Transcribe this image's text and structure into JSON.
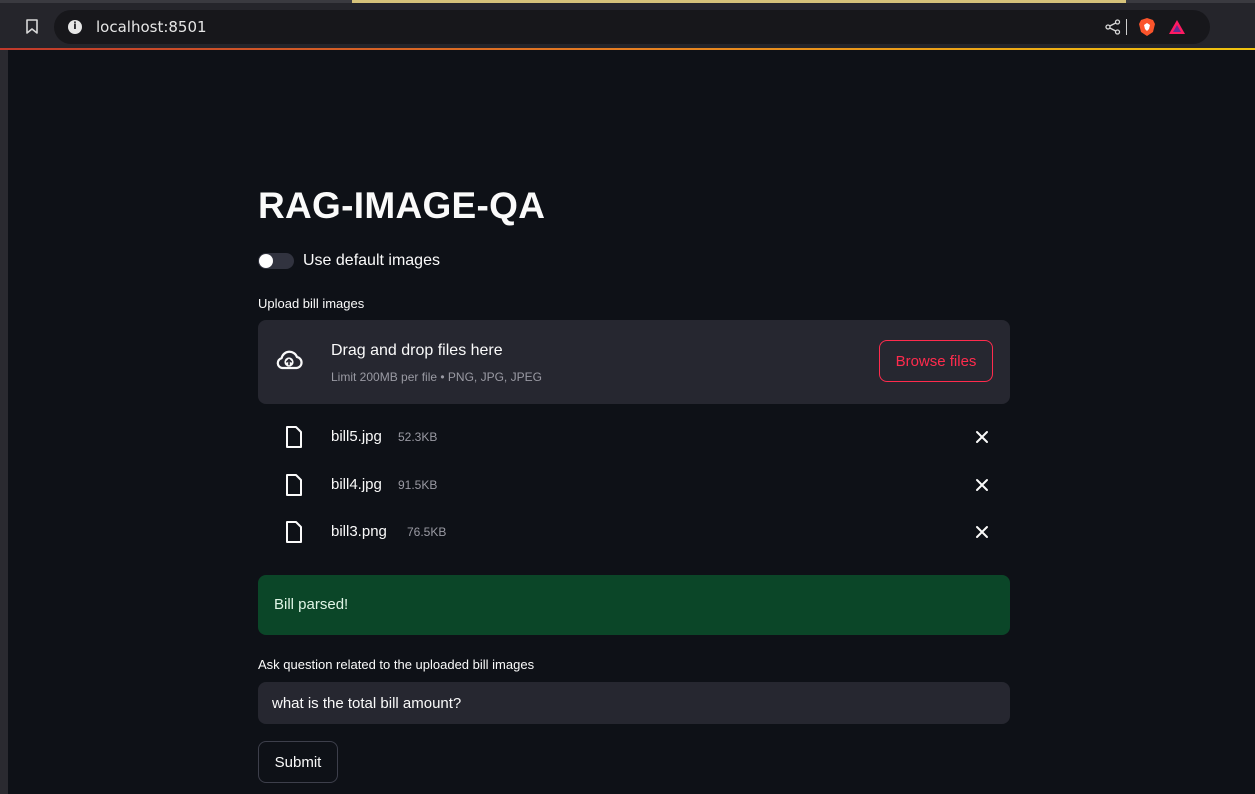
{
  "browser": {
    "url": "localhost:8501"
  },
  "app": {
    "title": "RAG-IMAGE-QA",
    "toggle": {
      "label": "Use default images",
      "on": false
    },
    "uploader": {
      "label": "Upload bill images",
      "drop_title": "Drag and drop files here",
      "limit_text": "Limit 200MB per file • PNG, JPG, JPEG",
      "browse_label": "Browse files"
    },
    "files": [
      {
        "name": "bill5.jpg",
        "size": "52.3KB"
      },
      {
        "name": "bill4.jpg",
        "size": "91.5KB"
      },
      {
        "name": "bill3.png",
        "size": "76.5KB"
      }
    ],
    "status": {
      "message": "Bill parsed!"
    },
    "question": {
      "label": "Ask question related to the uploaded bill images",
      "value": "what is the total bill amount?"
    },
    "submit_label": "Submit"
  },
  "colors": {
    "background": "#0e1117",
    "primary": "#ff2b4d",
    "success_bg": "#0b4628",
    "panel": "#262730"
  }
}
